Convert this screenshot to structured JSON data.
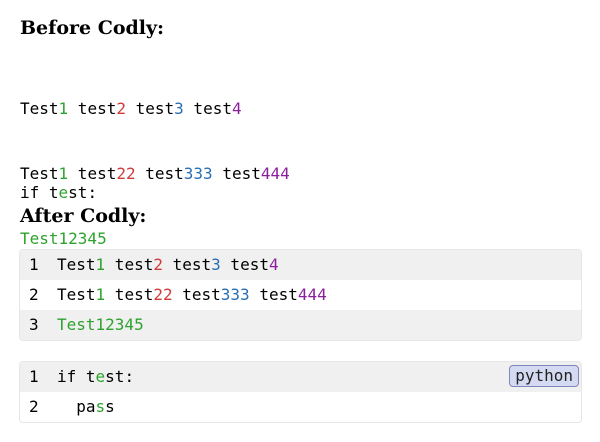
{
  "headings": {
    "before": "Before Codly:",
    "after": "After Codly:"
  },
  "snippet1": [
    [
      {
        "t": "Test",
        "c": ""
      },
      {
        "t": "1",
        "c": "g"
      },
      {
        "t": " test",
        "c": ""
      },
      {
        "t": "2",
        "c": "r"
      },
      {
        "t": " test",
        "c": ""
      },
      {
        "t": "3",
        "c": "b"
      },
      {
        "t": " test",
        "c": ""
      },
      {
        "t": "4",
        "c": "p"
      }
    ],
    [
      {
        "t": "Test",
        "c": ""
      },
      {
        "t": "1",
        "c": "g"
      },
      {
        "t": " test",
        "c": ""
      },
      {
        "t": "22",
        "c": "r"
      },
      {
        "t": " test",
        "c": ""
      },
      {
        "t": "333",
        "c": "b"
      },
      {
        "t": " test",
        "c": ""
      },
      {
        "t": "444",
        "c": "p"
      }
    ],
    [
      {
        "t": "Test12345",
        "c": "g"
      }
    ]
  ],
  "snippet2": [
    [
      {
        "t": "if t",
        "c": ""
      },
      {
        "t": "e",
        "c": "g"
      },
      {
        "t": "st:",
        "c": ""
      }
    ],
    [
      {
        "t": "  pa",
        "c": ""
      },
      {
        "t": "s",
        "c": "g"
      },
      {
        "t": "s",
        "c": ""
      }
    ]
  ],
  "line_numbers_block1": [
    "1",
    "2",
    "3"
  ],
  "line_numbers_block2": [
    "1",
    "2"
  ],
  "language_badge": "python",
  "colors": {
    "green": "#2ea22e",
    "red": "#d13a3a",
    "blue": "#2a6eb5",
    "purple": "#8a1f9c",
    "zebra": "#f0f0f0",
    "badge_fill": "#d4daf2",
    "badge_border": "#7f88bd"
  }
}
